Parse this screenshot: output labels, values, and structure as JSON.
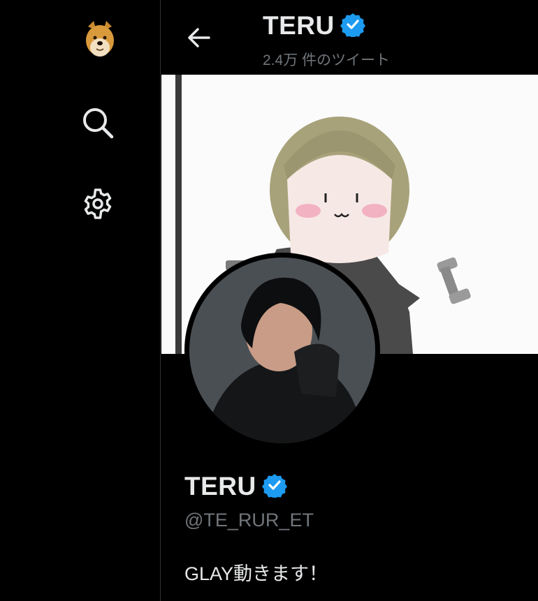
{
  "sidebar": {
    "logo_icon": "doge-logo-icon",
    "items": [
      {
        "icon": "search-icon"
      },
      {
        "icon": "gear-icon"
      }
    ]
  },
  "header": {
    "name": "TERU",
    "tweet_count": "2.4万 件のツイート",
    "back_icon": "back-arrow-icon"
  },
  "profile": {
    "name": "TERU",
    "handle": "@TE_RUR_ET",
    "bio": "GLAY動きます！",
    "verified": true
  },
  "colors": {
    "background": "#000000",
    "text": "#e7e9ea",
    "secondary_text": "#71767b",
    "verified_badge": "#1d9bf0",
    "divider": "#2f3336"
  }
}
